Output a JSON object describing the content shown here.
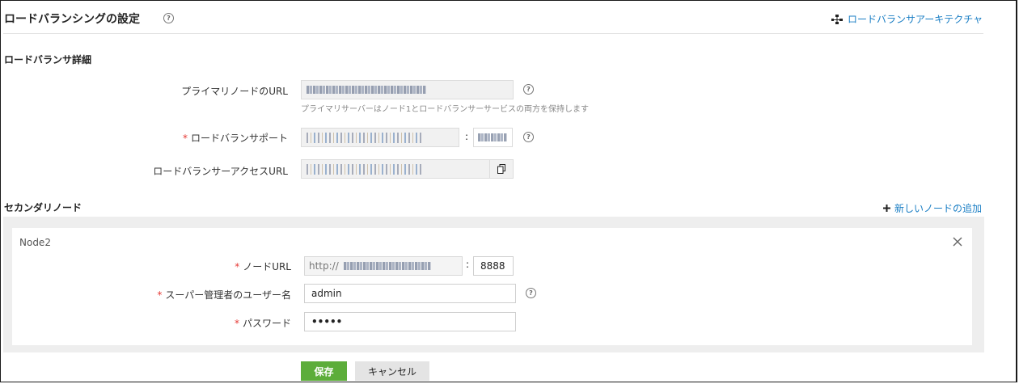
{
  "header": {
    "title": "ロードバランシングの設定",
    "architecture_link": "ロードバランサアーキテクチャ"
  },
  "lb_details": {
    "section_title": "ロードバランサ詳細",
    "primary_url_label": "プライマリノードのURL",
    "primary_url_hint": "プライマリサーバーはノード1とロードバランサーサービスの両方を保持します",
    "port_label": "ロードバランサポート",
    "port_separator": ":",
    "access_url_label": "ロードバランサーアクセスURL"
  },
  "secondary": {
    "section_title": "セカンダリノード",
    "add_node_label": "新しいノードの追加",
    "node": {
      "name": "Node2",
      "url_label": "ノードURL",
      "url_prefix": "http://",
      "port_separator": ":",
      "port_value": "8888",
      "admin_user_label": "スーパー管理者のユーザー名",
      "admin_user_value": "admin",
      "password_label": "パスワード",
      "password_value": "•••••",
      "required_mark": "*"
    }
  },
  "actions": {
    "save_label": "保存",
    "cancel_label": "キャンセル"
  },
  "icons": {
    "help": "help-circle-icon",
    "architecture": "network-icon",
    "copy": "copy-icon",
    "close": "close-icon",
    "add": "plus-icon"
  },
  "colors": {
    "link": "#1a7ec4",
    "save": "#5cad3a",
    "required": "#e53935"
  }
}
